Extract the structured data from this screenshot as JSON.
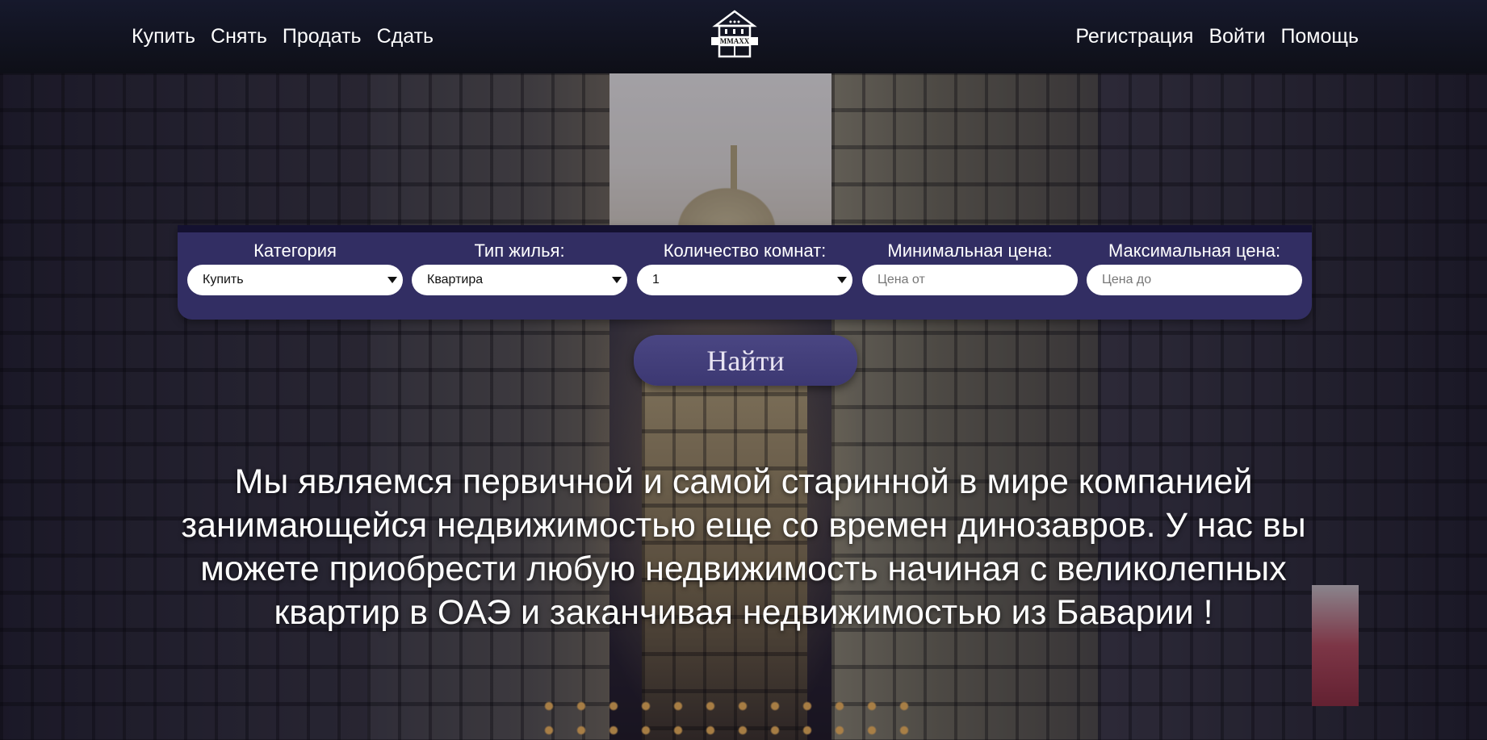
{
  "header": {
    "nav_left": [
      "Купить",
      "Снять",
      "Продать",
      "Сдать"
    ],
    "nav_right": [
      "Регистрация",
      "Войти",
      "Помощь"
    ],
    "logo_icon": "house-logo-icon",
    "logo_text": "ММАХХ"
  },
  "search": {
    "category": {
      "label": "Категория",
      "value": "Купить"
    },
    "housing_type": {
      "label": "Тип жилья:",
      "value": "Квартира"
    },
    "rooms": {
      "label": "Количество комнат:",
      "value": "1"
    },
    "min_price": {
      "label": "Минимальная цена:",
      "placeholder": "Цена от"
    },
    "max_price": {
      "label": "Максимальная цена:",
      "placeholder": "Цена до"
    },
    "find_label": "Найти"
  },
  "main": {
    "tagline": "Мы являемся первичной и самой старинной в мире компанией занимающейся недвижимостью еще со времен динозавров. У нас вы можете приобрести любую недвижимость начиная с великолепных квартир в ОАЭ и заканчивая недвижимостью из Баварии !"
  },
  "colors": {
    "header_bg": "#0e0f17",
    "panel_bg": "#322e63",
    "button_bg": "#3c3872",
    "text": "#ffffff"
  }
}
